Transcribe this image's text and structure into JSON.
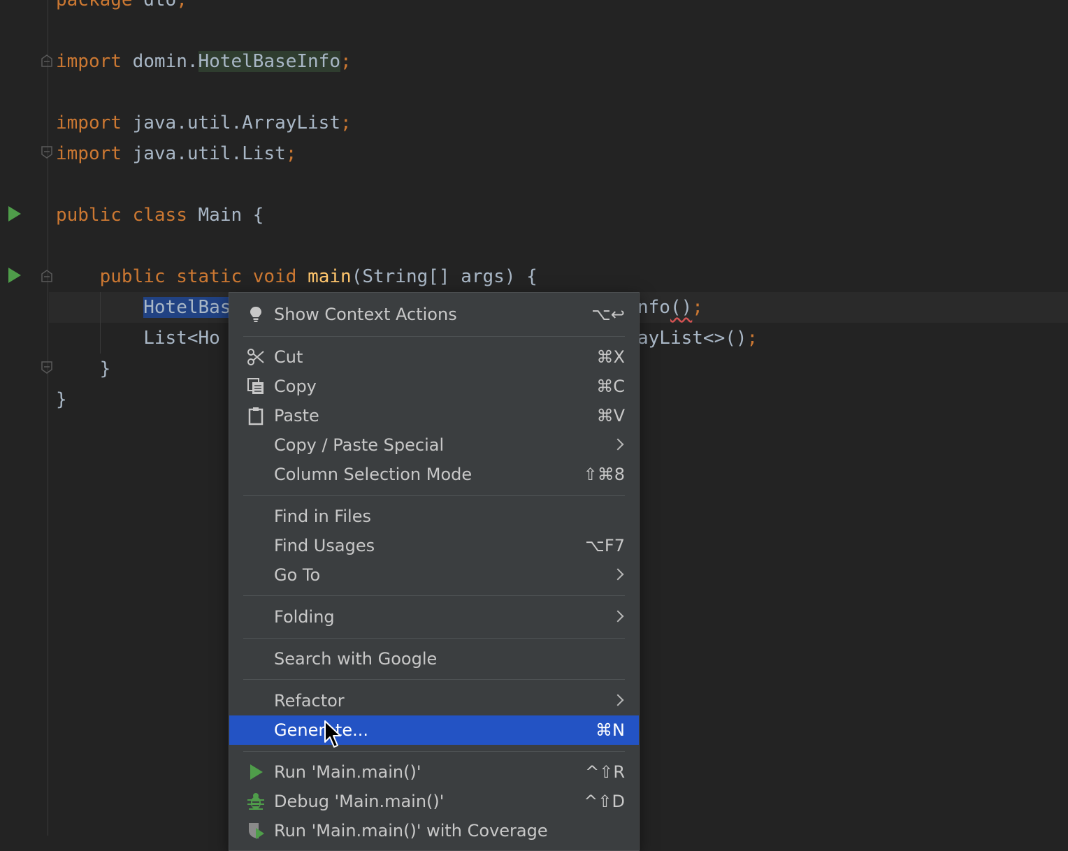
{
  "editor": {
    "lines": [
      {
        "id": "line-package",
        "segments": [
          {
            "t": "package",
            "c": "kw"
          },
          {
            "t": " dto",
            "c": ""
          },
          {
            "t": ";",
            "c": "pun"
          }
        ]
      },
      {
        "id": "line-import-1",
        "segments": [
          {
            "t": "import",
            "c": "kw"
          },
          {
            "t": " domin.",
            "c": ""
          },
          {
            "t": "HotelBaseInfo",
            "c": "cls-hl"
          },
          {
            "t": ";",
            "c": "pun"
          }
        ]
      },
      {
        "id": "line-import-2",
        "segments": [
          {
            "t": "import",
            "c": "kw"
          },
          {
            "t": " java.util.ArrayList",
            "c": ""
          },
          {
            "t": ";",
            "c": "pun"
          }
        ]
      },
      {
        "id": "line-import-3",
        "segments": [
          {
            "t": "import",
            "c": "kw"
          },
          {
            "t": " java.util.List",
            "c": ""
          },
          {
            "t": ";",
            "c": "pun"
          }
        ]
      },
      {
        "id": "line-class",
        "segments": [
          {
            "t": "public",
            "c": "kw"
          },
          {
            "t": " ",
            "c": ""
          },
          {
            "t": "class",
            "c": "kw"
          },
          {
            "t": " Main {",
            "c": ""
          }
        ]
      },
      {
        "id": "line-main",
        "segments": [
          {
            "t": "    ",
            "c": ""
          },
          {
            "t": "public",
            "c": "kw"
          },
          {
            "t": " ",
            "c": ""
          },
          {
            "t": "static",
            "c": "kw"
          },
          {
            "t": " ",
            "c": ""
          },
          {
            "t": "void",
            "c": "kw"
          },
          {
            "t": " ",
            "c": ""
          },
          {
            "t": "main",
            "c": "fn"
          },
          {
            "t": "(String[] args) {",
            "c": ""
          }
        ]
      },
      {
        "id": "line-stmt-1a",
        "segments": [
          {
            "t": "        ",
            "c": ""
          },
          {
            "t": "HotelBas",
            "c": "sel-hl"
          }
        ]
      },
      {
        "id": "line-stmt-2a",
        "segments": [
          {
            "t": "        List<Ho",
            "c": ""
          }
        ]
      },
      {
        "id": "line-close-method",
        "segments": [
          {
            "t": "    }",
            "c": ""
          }
        ]
      },
      {
        "id": "line-close-class",
        "segments": [
          {
            "t": "}",
            "c": ""
          }
        ]
      }
    ],
    "right_fragments": {
      "stmt1_text": "nfo",
      "stmt1_paren": "()",
      "stmt1_semi": ";",
      "stmt2_text": "ayList<>()",
      "stmt2_semi": ";"
    }
  },
  "context_menu": {
    "items": [
      {
        "id": "show-context-actions",
        "label": "Show Context Actions",
        "shortcut": "⌥↩",
        "icon": "bulb-icon"
      },
      {
        "id": "cut",
        "label": "Cut",
        "shortcut": "⌘X",
        "icon": "scissors-icon"
      },
      {
        "id": "copy",
        "label": "Copy",
        "shortcut": "⌘C",
        "icon": "copy-icon"
      },
      {
        "id": "paste",
        "label": "Paste",
        "shortcut": "⌘V",
        "icon": "clipboard-icon"
      },
      {
        "id": "copy-paste-special",
        "label": "Copy / Paste Special",
        "submenu": true
      },
      {
        "id": "column-selection-mode",
        "label": "Column Selection Mode",
        "shortcut": "⇧⌘8"
      },
      {
        "id": "find-in-files",
        "label": "Find in Files"
      },
      {
        "id": "find-usages",
        "label": "Find Usages",
        "shortcut": "⌥F7"
      },
      {
        "id": "go-to",
        "label": "Go To",
        "submenu": true
      },
      {
        "id": "folding",
        "label": "Folding",
        "submenu": true
      },
      {
        "id": "search-with-google",
        "label": "Search with Google"
      },
      {
        "id": "refactor",
        "label": "Refactor",
        "submenu": true
      },
      {
        "id": "generate",
        "label": "Generate...",
        "shortcut": "⌘N",
        "highlighted": true
      },
      {
        "id": "run-main",
        "label": "Run 'Main.main()'",
        "shortcut": "^⇧R",
        "icon": "run-icon"
      },
      {
        "id": "debug-main",
        "label": "Debug 'Main.main()'",
        "shortcut": "^⇧D",
        "icon": "bug-icon"
      },
      {
        "id": "run-coverage",
        "label": "Run 'Main.main()' with Coverage",
        "icon": "coverage-icon"
      }
    ]
  },
  "colors": {
    "background": "#232323",
    "keyword": "#cc7832",
    "identifier": "#a9b7c6",
    "method": "#ffc66d",
    "menu_bg": "#3b3e40",
    "menu_highlight": "#2353c4",
    "run_green": "#4f9d4a"
  }
}
